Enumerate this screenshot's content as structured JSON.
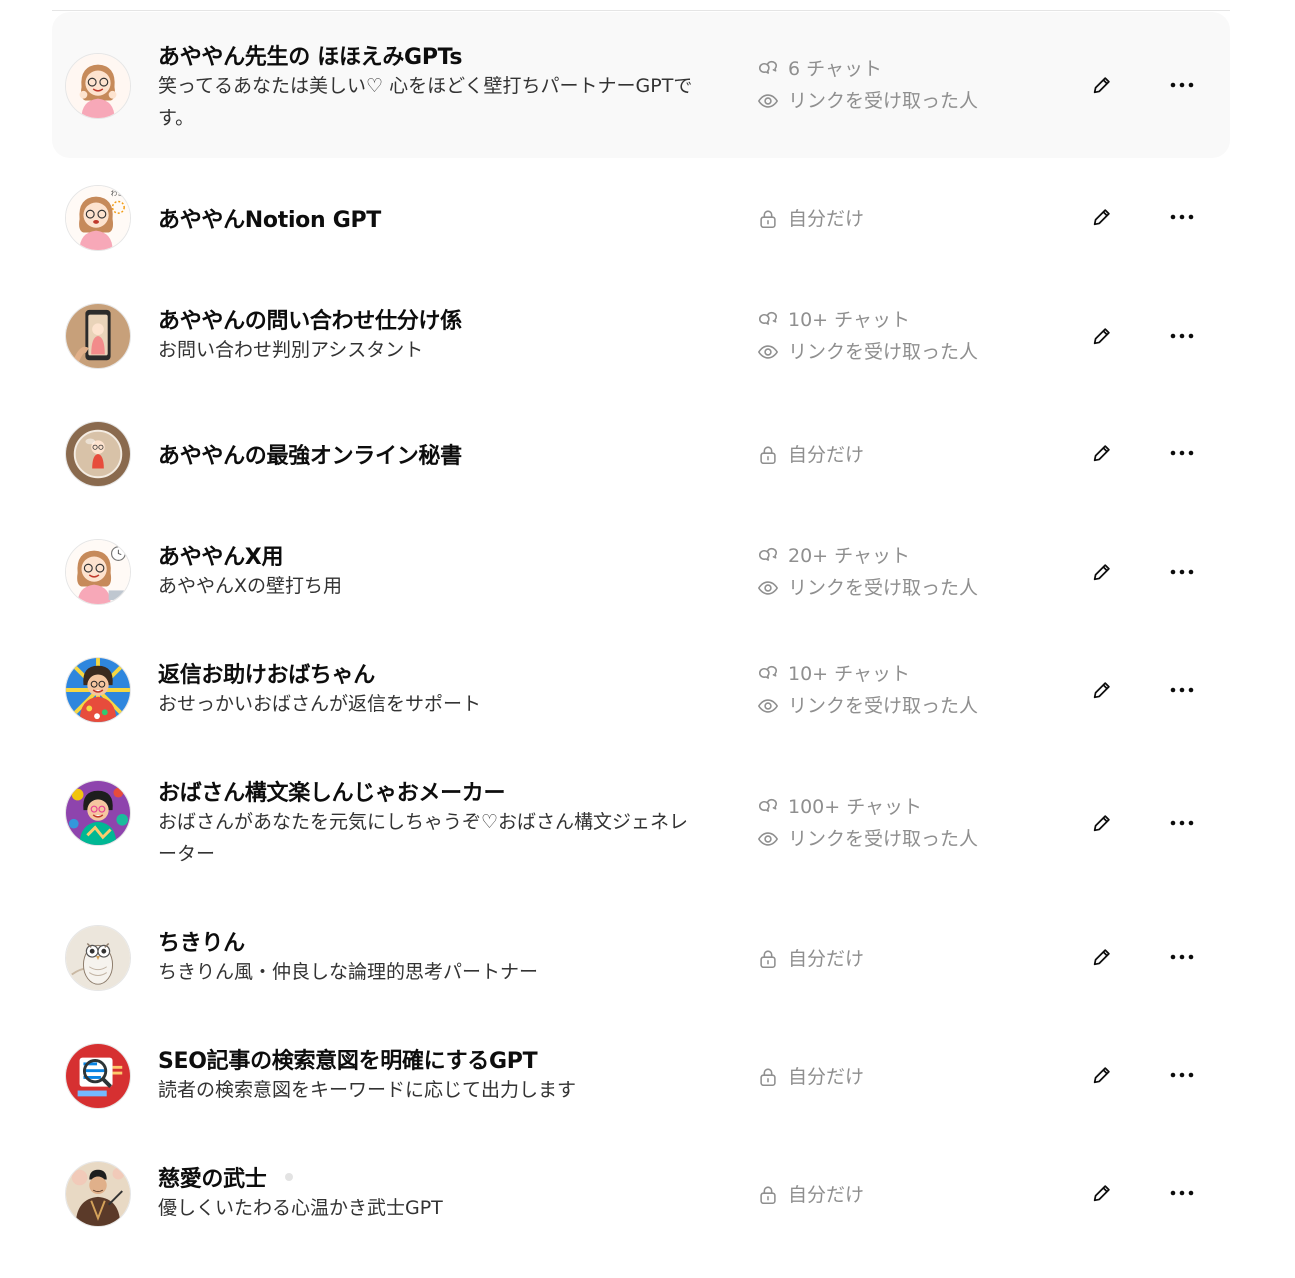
{
  "gpts": [
    {
      "title": "あややん先生の ほほえみGPTs",
      "description": "笑ってるあなたは美しい♡ 心をほどく壁打ちパートナーGPTです。",
      "chats": "6 チャット",
      "visibility": "リンクを受け取った人",
      "avatar": "woman-smiling-avatar",
      "hovered": true
    },
    {
      "title": "あややんNotion GPT",
      "visibility": "自分だけ",
      "avatar": "woman-wow-avatar"
    },
    {
      "title": "あややんの問い合わせ仕分け係",
      "description": "お問い合わせ判別アシスタント",
      "chats": "10+ チャット",
      "visibility": "リンクを受け取った人",
      "avatar": "phone-doll-avatar"
    },
    {
      "title": "あややんの最強オンライン秘書",
      "visibility": "自分だけ",
      "avatar": "glass-sphere-doll-avatar"
    },
    {
      "title": "あややんX用",
      "description": "あややんXの壁打ち用",
      "chats": "20+ チャット",
      "visibility": "リンクを受け取った人",
      "avatar": "woman-clock-laptop-avatar"
    },
    {
      "title": "返信お助けおばちゃん",
      "description": "おせっかいおばさんが返信をサポート",
      "chats": "10+ チャット",
      "visibility": "リンクを受け取った人",
      "avatar": "pop-art-auntie-avatar"
    },
    {
      "title": "おばさん構文楽しんじゃおメーカー",
      "description": "おばさんがあなたを元気にしちゃうぞ♡おばさん構文ジェネレーター",
      "chats": "100+ チャット",
      "visibility": "リンクを受け取った人",
      "avatar": "colorful-auntie-avatar"
    },
    {
      "title": "ちきりん",
      "description": "ちきりん風・仲良しな論理的思考パートナー",
      "visibility": "自分だけ",
      "avatar": "owl-avatar"
    },
    {
      "title": "SEO記事の検索意図を明確にするGPT",
      "description": "読者の検索意図をキーワードに応じて出力します",
      "visibility": "自分だけ",
      "avatar": "seo-magnifier-avatar"
    },
    {
      "title": "慈愛の武士",
      "description": "優しくいたわる心温かき武士GPT",
      "visibility": "自分だけ",
      "avatar": "samurai-avatar",
      "status_dot": true
    }
  ]
}
